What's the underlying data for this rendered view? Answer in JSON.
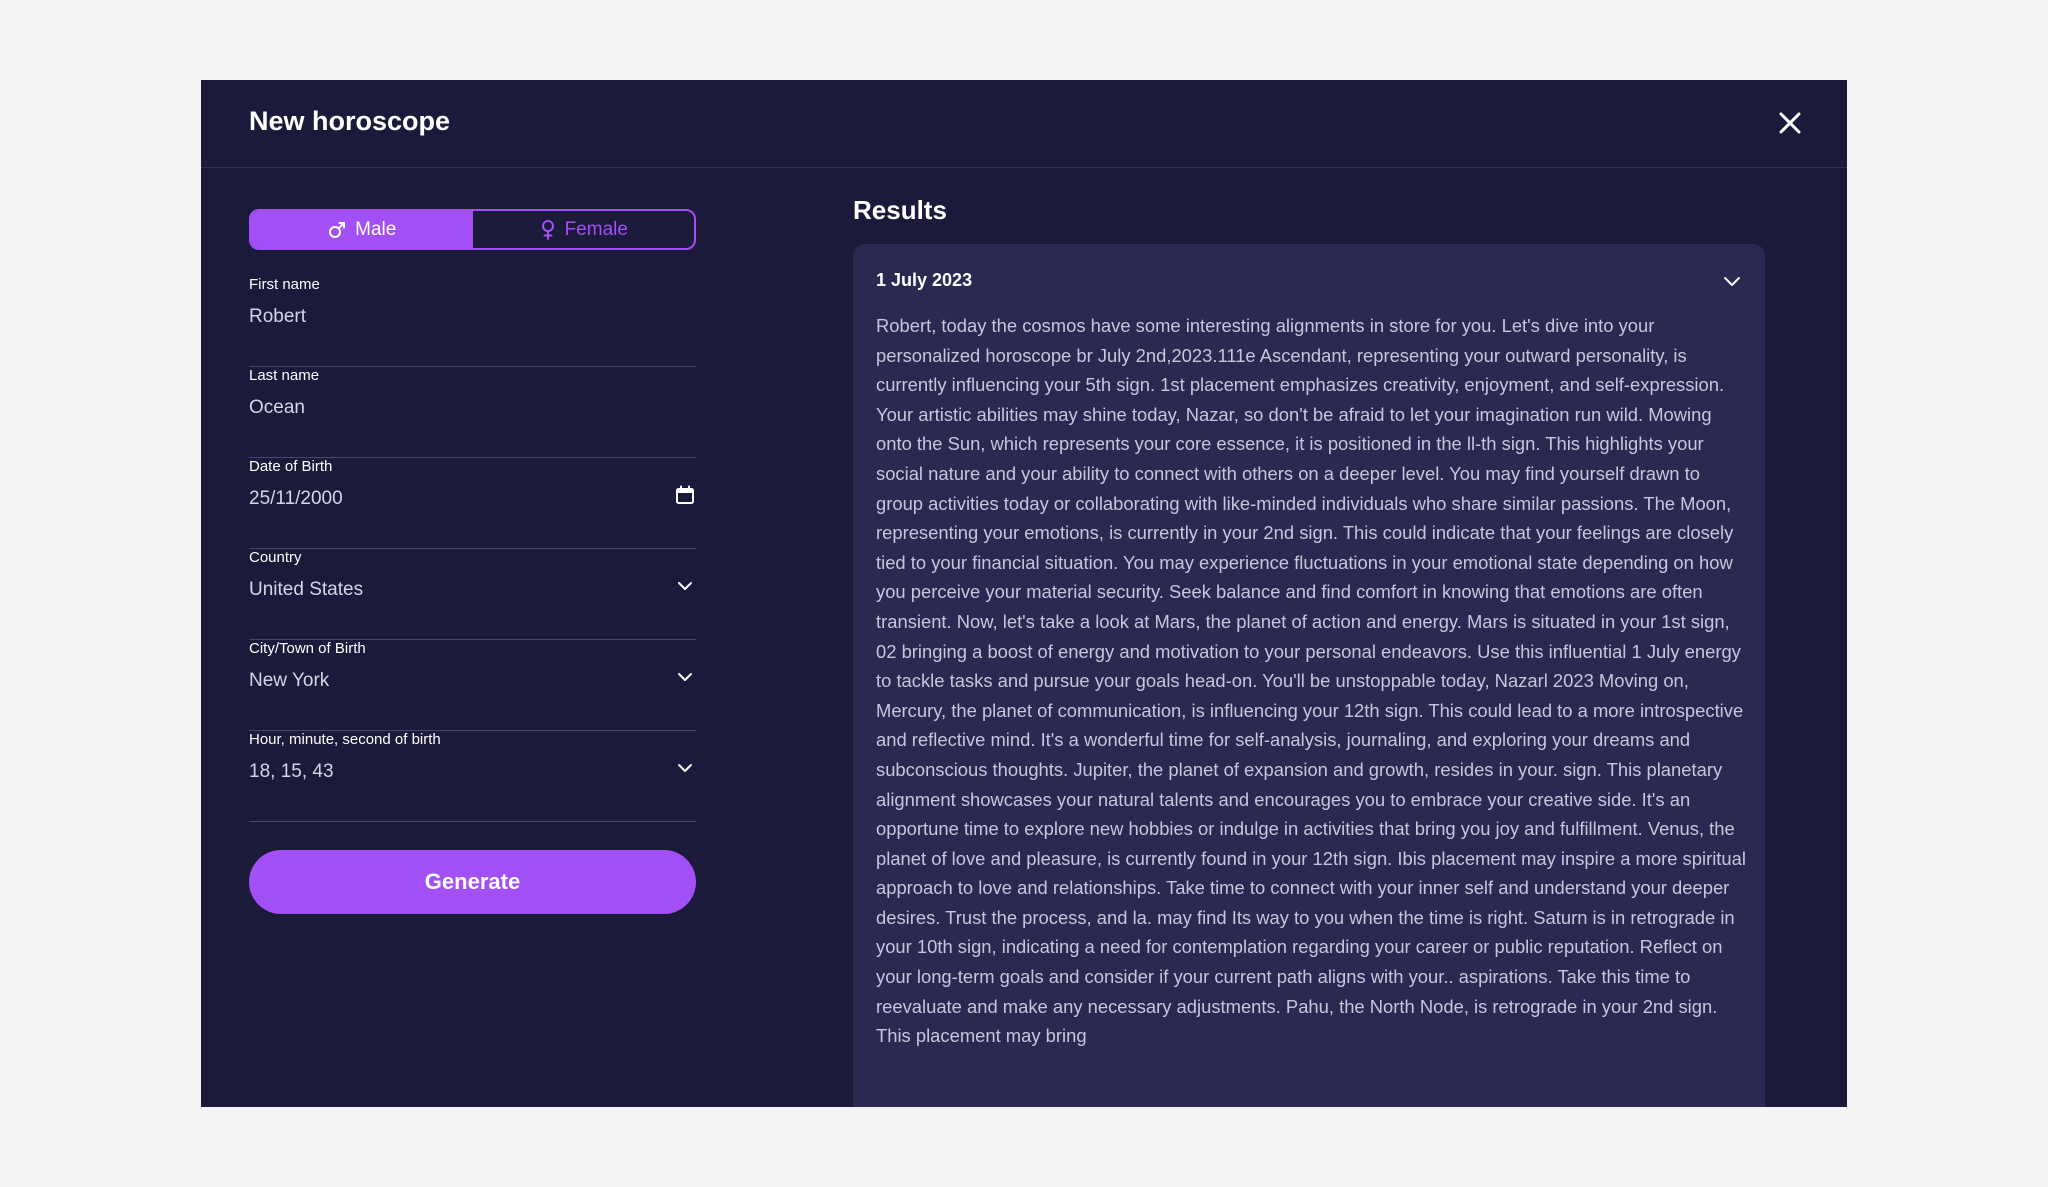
{
  "modal": {
    "title": "New horoscope",
    "close_icon": "close-icon"
  },
  "form": {
    "gender": {
      "male_label": "Male",
      "female_label": "Female",
      "selected": "Male"
    },
    "first_name": {
      "label": "First name",
      "value": "Robert"
    },
    "last_name": {
      "label": "Last name",
      "value": "Ocean"
    },
    "dob": {
      "label": "Date of Birth",
      "value": "25/11/2000",
      "icon": "calendar-icon"
    },
    "country": {
      "label": "Country",
      "value": "United States",
      "icon": "chevron-down-icon"
    },
    "city": {
      "label": "City/Town of Birth",
      "value": "New York",
      "icon": "chevron-down-icon"
    },
    "time": {
      "label": "Hour, minute, second of birth",
      "value": "18, 15, 43",
      "icon": "chevron-down-icon"
    },
    "generate_label": "Generate"
  },
  "results": {
    "title": "Results",
    "date": "1 July 2023",
    "text": "Robert, today the cosmos have some interesting alignments in store for you. Let's dive into your personalized horoscope br July 2nd,2023.111e Ascendant, representing your outward personality, is currently influencing your 5th sign. 1st placement emphasizes creativity, enjoyment, and self-expression. Your artistic abilities may shine today, Nazar, so don't be afraid to let your imagination run wild. Mowing onto the Sun, which represents your core essence, it is positioned in the ll-th sign. This highlights your social nature and your ability to connect with others on a deeper level. You may find yourself drawn to group activities today or collaborating with like-minded individuals who share similar passions. The Moon, representing your emotions, is currently in your 2nd sign. This could indicate that your feelings are closely tied to your financial situation. You may experience fluctuations in your emotional state depending on how you perceive your material security. Seek balance and find comfort in knowing that emotions are often transient. Now, let's take a look at Mars, the planet of action and energy. Mars is situated in your 1st sign, 02 bringing a boost of energy and motivation to your personal endeavors. Use this influential 1 July energy to tackle tasks and pursue your goals head-on. You'll be unstoppable today, Nazarl 2023 Moving on, Mercury, the planet of communication, is influencing your 12th sign. This could lead to a more introspective and reflective mind. It's a wonderful time for self-analysis, journaling, and exploring your dreams and subconscious thoughts. Jupiter, the planet of expansion and growth, resides in your. sign. This planetary alignment showcases your natural talents and encourages you to embrace your creative side. It's an opportune time to explore new hobbies or indulge in activities that bring you joy and fulfillment. Venus, the planet of love and pleasure, is currently found in your 12th sign. Ibis placement may inspire a more spiritual approach to love and relationships. Take time to connect with your inner self and understand your deeper desires. Trust the process, and la. may find Its way to you when the time is right. Saturn is in retrograde in your 10th sign, indicating a need for contemplation regarding your career or public reputation. Reflect on your long-term goals and consider if your current path aligns with your.. aspirations. Take this time to reevaluate and make any necessary adjustments. Pahu, the North Node, is retrograde in your 2nd sign. This placement may bring"
  },
  "colors": {
    "accent": "#a24ff5",
    "modal_bg": "#1c1a3a",
    "card_bg": "#2b2851",
    "page_bg": "#f4f4f5"
  }
}
